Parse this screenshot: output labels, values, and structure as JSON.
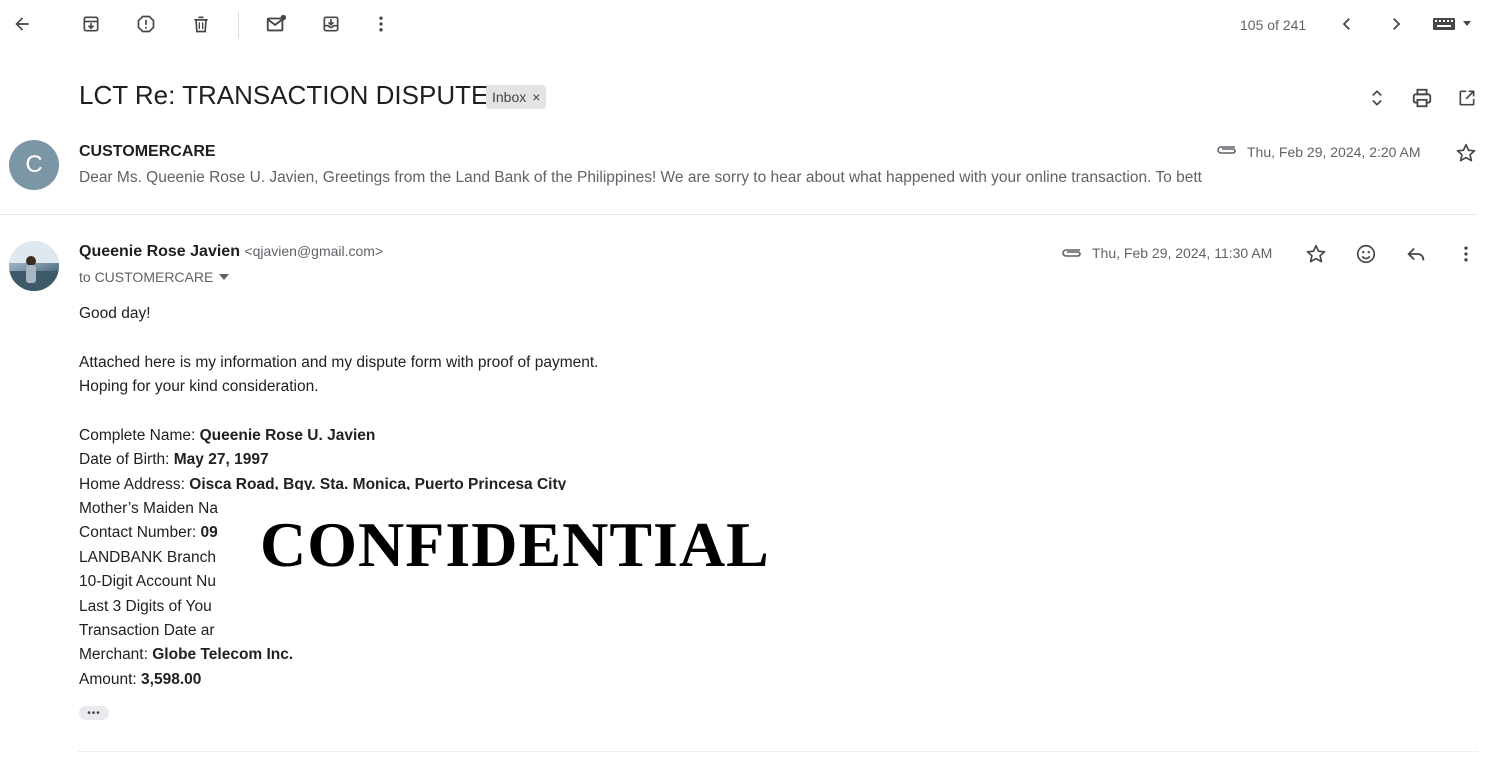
{
  "toolbar": {
    "pager_text": "105 of 241"
  },
  "thread": {
    "subject": "LCT Re: TRANSACTION DISPUTE",
    "label": "Inbox",
    "label_remove": "×"
  },
  "message1": {
    "avatar_letter": "C",
    "sender": "CUSTOMERCARE",
    "date": "Thu, Feb 29, 2024, 2:20 AM",
    "snippet": "Dear Ms. Queenie Rose U. Javien, Greetings from the Land Bank of the Philippines! We are sorry to hear about what happened with your online transaction. To bett"
  },
  "message2": {
    "sender_name": "Queenie Rose Javien",
    "sender_email": "<qjavien@gmail.com>",
    "to": "to CUSTOMERCARE",
    "date": "Thu, Feb 29, 2024, 11:30 AM",
    "greeting": "Good day!",
    "line1": "Attached here is my information and my dispute form with proof of payment.",
    "line2": "Hoping for your kind consideration.",
    "fields": [
      {
        "label": "Complete Name: ",
        "value": "Queenie Rose U. Javien"
      },
      {
        "label": "Date of Birth: ",
        "value": "May 27, 1997"
      },
      {
        "label": "Home Address: ",
        "value": "Oisca Road, Bgy. Sta. Monica, Puerto Princesa City"
      },
      {
        "label": "Mother’s Maiden Na",
        "value": ""
      },
      {
        "label": "Contact Number: ",
        "value": "09"
      },
      {
        "label": "LANDBANK Branch",
        "value": ""
      },
      {
        "label": "10-Digit Account Nu",
        "value": ""
      },
      {
        "label": "Last 3 Digits of You",
        "value": ""
      },
      {
        "label": "Transaction Date ar",
        "value": ""
      },
      {
        "label": "Merchant: ",
        "value": "Globe Telecom Inc."
      },
      {
        "label": "Amount: ",
        "value": "3,598.00"
      }
    ],
    "redaction_text": "CONFIDENTIAL",
    "more_label": "•••"
  },
  "colors": {
    "avatar_bg": "#7b96a4",
    "label_bg": "#e3e3e3"
  }
}
